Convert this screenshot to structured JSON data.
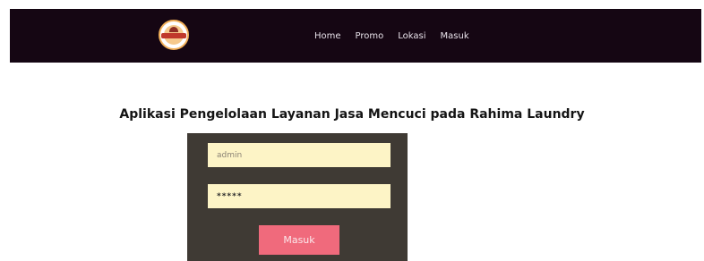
{
  "navbar": {
    "links": [
      {
        "label": "Home"
      },
      {
        "label": "Promo"
      },
      {
        "label": "Lokasi"
      },
      {
        "label": "Masuk"
      }
    ]
  },
  "main": {
    "title": "Aplikasi Pengelolaan Layanan Jasa Mencuci pada Rahima Laundry"
  },
  "login": {
    "username_value": "admin",
    "password_value": "*****",
    "submit_label": "Masuk"
  },
  "colors": {
    "navbar_bg": "#150613",
    "panel_bg": "#3f3a34",
    "input_bg": "#fdf4c6",
    "button_bg": "#f06a7c"
  }
}
